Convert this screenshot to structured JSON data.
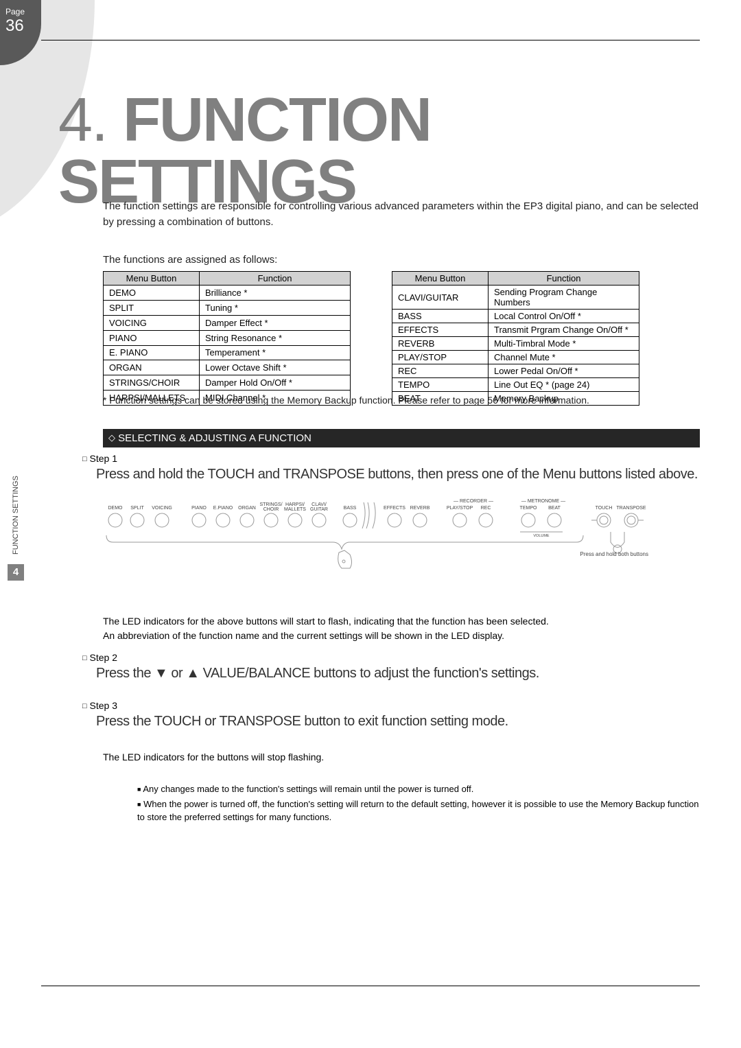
{
  "page_label": "Page",
  "page_number": "36",
  "chapter_number": "4.",
  "chapter_title": "FUNCTION SETTINGS",
  "intro_para": "The function settings are responsible for controlling various advanced parameters within the EP3 digital piano, and can be selected by pressing a combination of buttons.",
  "assigned_heading": "The functions are assigned as follows:",
  "table_headers": {
    "menu": "Menu Button",
    "function": "Function"
  },
  "table_left": [
    {
      "menu": "DEMO",
      "function": "Brilliance *"
    },
    {
      "menu": "SPLIT",
      "function": "Tuning *"
    },
    {
      "menu": "VOICING",
      "function": "Damper Effect *"
    },
    {
      "menu": "PIANO",
      "function": "String Resonance *"
    },
    {
      "menu": "E. PIANO",
      "function": "Temperament *"
    },
    {
      "menu": "ORGAN",
      "function": "Lower Octave Shift *"
    },
    {
      "menu": "STRINGS/CHOIR",
      "function": "Damper Hold On/Off *"
    },
    {
      "menu": "HARPSI/MALLETS",
      "function": "MIDI Channel *"
    }
  ],
  "table_right": [
    {
      "menu": "CLAVI/GUITAR",
      "function": "Sending Program Change Numbers"
    },
    {
      "menu": "BASS",
      "function": "Local Control On/Off *"
    },
    {
      "menu": "EFFECTS",
      "function": "Transmit Prgram Change On/Off *"
    },
    {
      "menu": "REVERB",
      "function": "Multi-Timbral Mode *"
    },
    {
      "menu": "PLAY/STOP",
      "function": "Channel Mute *"
    },
    {
      "menu": "REC",
      "function": "Lower Pedal On/Off *"
    },
    {
      "menu": "TEMPO",
      "function": "Line Out EQ * (page 24)"
    },
    {
      "menu": "BEAT",
      "function": "Memory Backup"
    }
  ],
  "backup_note": "* Function settings can be stored using the Memory Backup function.  Please refer to page 56 for more information.",
  "section_heading": "SELECTING & ADJUSTING A FUNCTION",
  "section_number": "4",
  "vertical_label": "FUNCTION SETTINGS",
  "step1_label": "Step 1",
  "step1_instruction": "Press and hold the TOUCH and TRANSPOSE buttons, then press one of the Menu buttons listed above.",
  "panel_labels": {
    "demo": "DEMO",
    "split": "SPLIT",
    "voicing": "VOICING",
    "piano": "PIANO",
    "epiano": "E.PIANO",
    "organ": "ORGAN",
    "strings_top": "STRINGS/",
    "strings_bot": "CHOIR",
    "harpsi_top": "HARPSI/",
    "harpsi_bot": "MALLETS",
    "clavi_top": "CLAVI/",
    "clavi_bot": "GUITAR",
    "bass": "BASS",
    "effects": "EFFECTS",
    "reverb": "REVERB",
    "recorder": "— RECORDER —",
    "play": "PLAY/STOP",
    "rec": "REC",
    "metronome": "— METRONOME —",
    "tempo": "TEMPO",
    "beat": "BEAT",
    "volume": "VOLUME",
    "touch": "TOUCH",
    "transpose": "TRANSPOSE",
    "press_hold": "Press and hold both buttons"
  },
  "after_diagram_1": "The LED indicators for the above buttons will start to flash, indicating that the function has been selected.",
  "after_diagram_2": "An abbreviation of the function name and the current settings will be shown in the LED display.",
  "step2_label": "Step 2",
  "step2_instruction": "Press the ▼ or ▲ VALUE/BALANCE buttons to adjust the function's settings.",
  "step3_label": "Step 3",
  "step3_instruction": "Press the TOUCH or TRANSPOSE button to exit function setting mode.",
  "step3_followup": "The LED indicators for the buttons will stop flashing.",
  "note1": "Any changes made to the function's settings will remain until the power is turned off.",
  "note2": "When the power is turned off, the function's setting will return to the default setting, however it is possible to use the Memory Backup function to store the preferred settings for many functions."
}
